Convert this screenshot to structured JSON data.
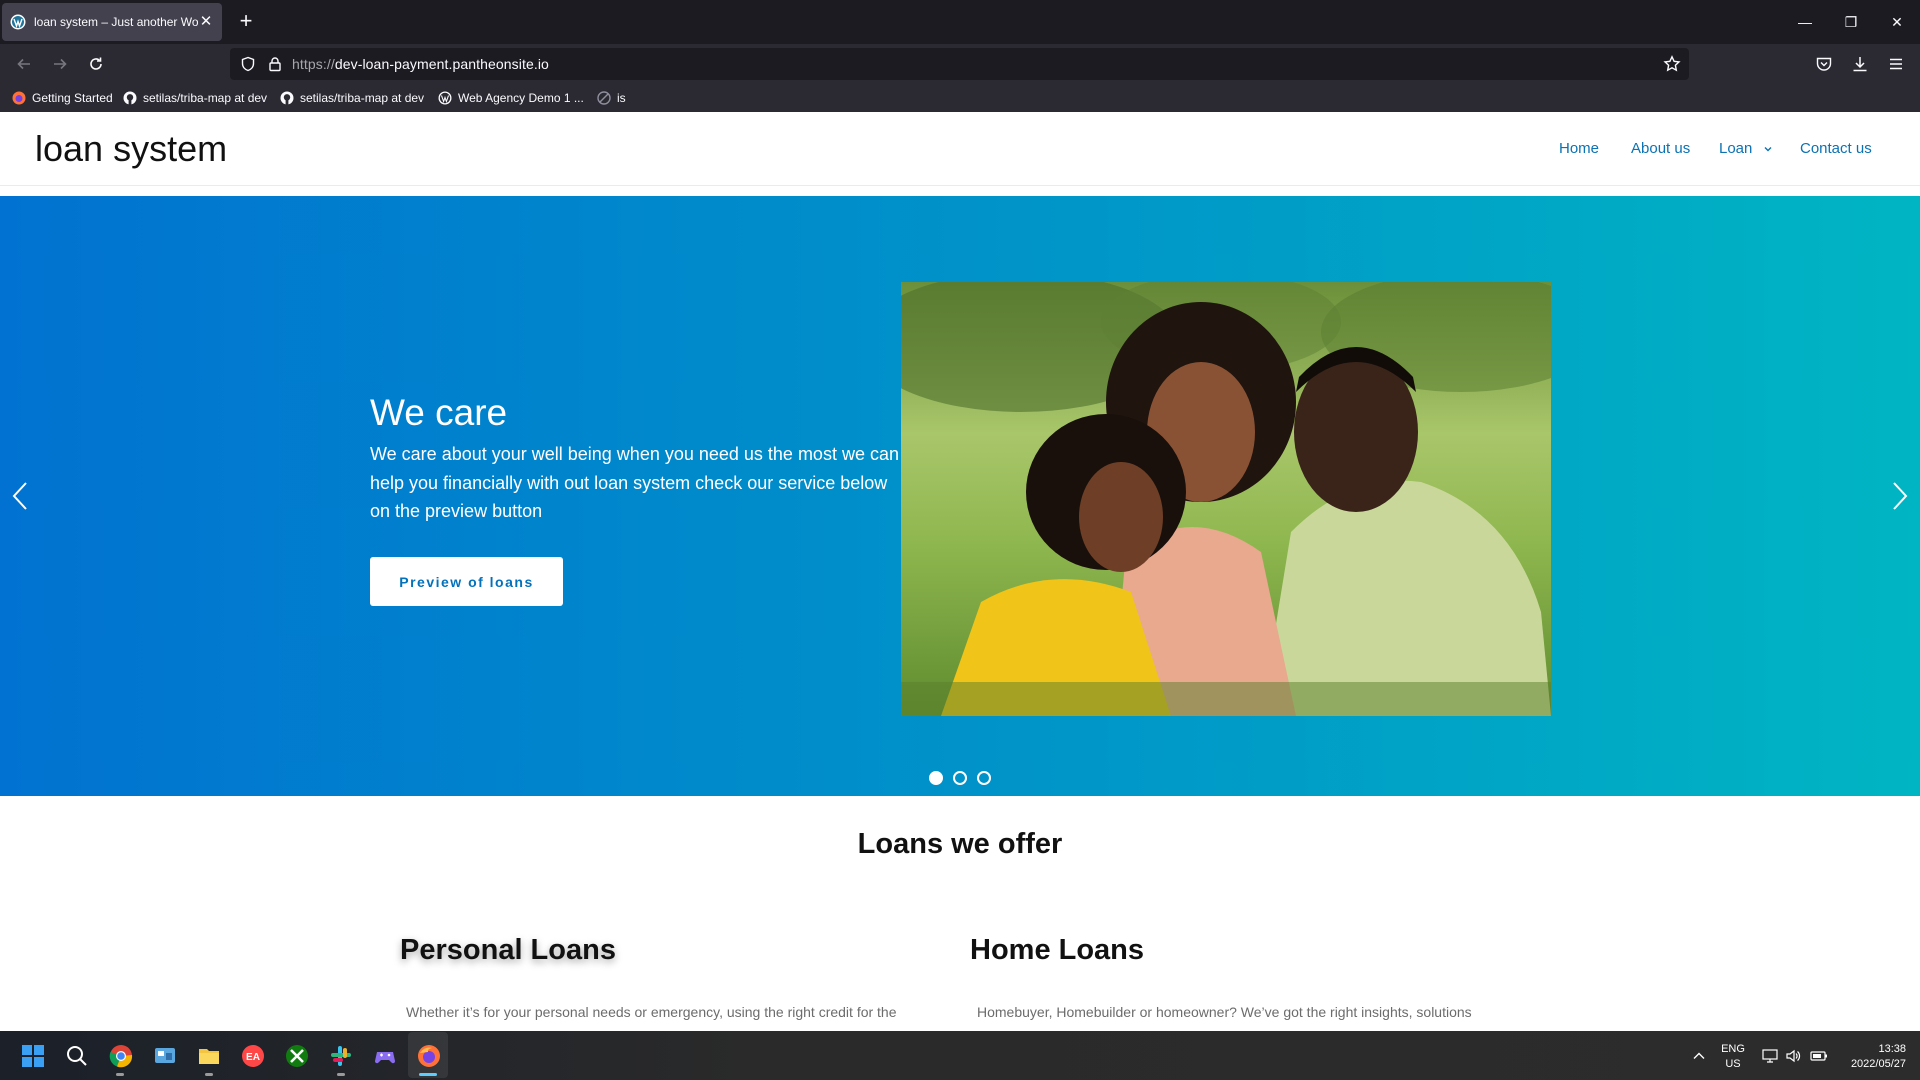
{
  "browser": {
    "tab_title": "loan system – Just another Wor",
    "url_proto": "https://",
    "url_host": "dev-loan-payment.pantheonsite.io",
    "bookmarks": [
      {
        "label": "Getting Started",
        "icon": "firefox-icon"
      },
      {
        "label": "setilas/triba-map at dev",
        "icon": "github-icon"
      },
      {
        "label": "setilas/triba-map at dev",
        "icon": "github-icon"
      },
      {
        "label": "Web Agency Demo 1 ...",
        "icon": "wordpress-icon"
      },
      {
        "label": "is",
        "icon": "generic-site-icon"
      }
    ]
  },
  "site": {
    "title": "loan system",
    "menu": [
      {
        "label": "Home"
      },
      {
        "label": "About us"
      },
      {
        "label": "Loan",
        "has_dropdown": true
      },
      {
        "label": "Contact us"
      }
    ]
  },
  "hero": {
    "title": "We care",
    "text": "We care about your well being when you need us the most we can help you financially with out loan system check our service below on the preview button",
    "button": "Preview of loans",
    "slides": 3,
    "active_slide": 1,
    "gradient": [
      "#0172d1",
      "#00b5c3"
    ]
  },
  "offers": {
    "title": "Loans we offer",
    "cards": [
      {
        "title": "Personal Loans",
        "text": "Whether it’s for your personal needs or emergency, using the right credit for the"
      },
      {
        "title": "Home Loans",
        "text": "Homebuyer, Homebuilder or homeowner? We’ve got the right insights, solutions"
      }
    ]
  },
  "taskbar": {
    "apps": [
      "windows-start-icon",
      "search-icon",
      "chrome-icon",
      "control-panel-icon",
      "file-explorer-icon",
      "ea-icon",
      "xbox-icon",
      "slack-icon",
      "game-controller-icon",
      "firefox-icon"
    ],
    "lang_top": "ENG",
    "lang_bottom": "US",
    "time": "13:38",
    "date": "2022/05/27"
  }
}
